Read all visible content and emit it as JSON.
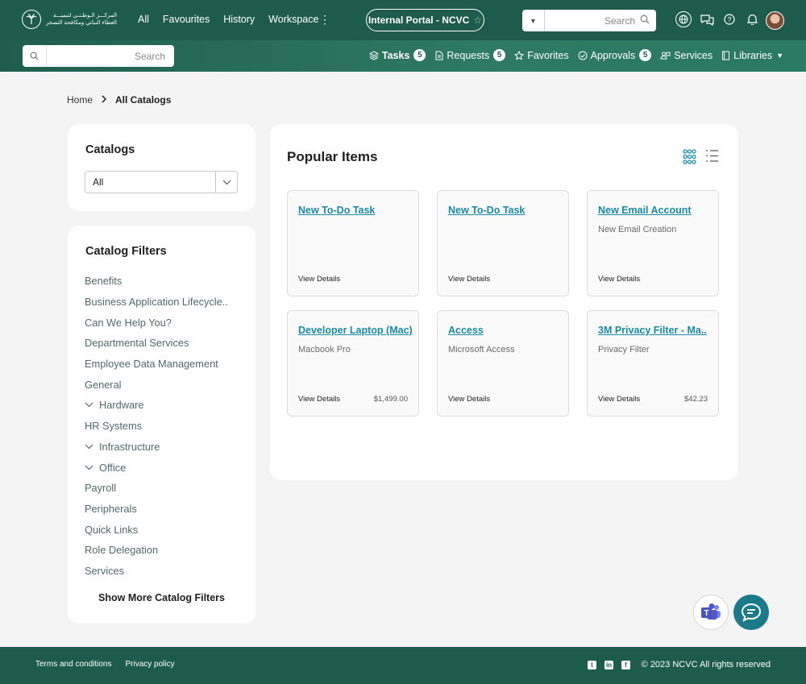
{
  "header": {
    "logo_text_line1": "المركـــز الـوطـنـي لتنميـــة",
    "logo_text_line2": "الغطاء النباتي ومكافحة التصحر",
    "nav": [
      "All",
      "Favourites",
      "History",
      "Workspace"
    ],
    "portal_label": "Internal Portal - NCVC",
    "search_placeholder": "Search",
    "icons": [
      "globe-icon",
      "chat-icon",
      "help-icon",
      "bell-icon"
    ]
  },
  "subbar": {
    "search_placeholder": "Search",
    "items": [
      {
        "label": "Tasks",
        "icon": "layers-icon",
        "badge": "5"
      },
      {
        "label": "Requests",
        "icon": "document-icon",
        "badge": "5"
      },
      {
        "label": "Favorites",
        "icon": "star-icon"
      },
      {
        "label": "Approvals",
        "icon": "check-circle-icon",
        "badge": "5"
      },
      {
        "label": "Services",
        "icon": "people-icon"
      },
      {
        "label": "Libraries",
        "icon": "book-icon"
      }
    ]
  },
  "breadcrumb": {
    "home": "Home",
    "current": "All Catalogs"
  },
  "catalogs": {
    "title": "Catalogs",
    "selected": "All"
  },
  "filters": {
    "title": "Catalog Filters",
    "items": [
      {
        "label": "Benefits",
        "expandable": false
      },
      {
        "label": "Business Application Lifecycle..",
        "expandable": false
      },
      {
        "label": "Can We Help You?",
        "expandable": false
      },
      {
        "label": "Departmental Services",
        "expandable": false
      },
      {
        "label": "Employee Data Management",
        "expandable": false
      },
      {
        "label": "General",
        "expandable": false
      },
      {
        "label": "Hardware",
        "expandable": true
      },
      {
        "label": "HR Systems",
        "expandable": false
      },
      {
        "label": "Infrastructure",
        "expandable": true
      },
      {
        "label": "Office",
        "expandable": true
      },
      {
        "label": "Payroll",
        "expandable": false
      },
      {
        "label": "Peripherals",
        "expandable": false
      },
      {
        "label": "Quick Links",
        "expandable": false
      },
      {
        "label": "Role Delegation",
        "expandable": false
      },
      {
        "label": "Services",
        "expandable": false
      }
    ],
    "show_more": "Show More Catalog Filters"
  },
  "popular": {
    "title": "Popular Items",
    "cards": [
      {
        "title": "New To-Do Task",
        "subtitle": "",
        "action": "View Details",
        "price": ""
      },
      {
        "title": "New To-Do Task",
        "subtitle": "",
        "action": "View Details",
        "price": ""
      },
      {
        "title": "New Email Account",
        "subtitle": "New Email Creation",
        "action": "View Details",
        "price": ""
      },
      {
        "title": "Developer Laptop (Mac)",
        "subtitle": "Macbook Pro",
        "action": "View Details",
        "price": "$1,499.00"
      },
      {
        "title": "Access",
        "subtitle": "Microsoft Access",
        "action": "View Details",
        "price": ""
      },
      {
        "title": "3M Privacy Filter - Ma..",
        "subtitle": "Privacy Filter",
        "action": "View Details",
        "price": "$42.23"
      }
    ]
  },
  "footer": {
    "links": [
      "Terms and conditions",
      "Privacy policy"
    ],
    "social": [
      "twitter-icon",
      "linkedin-icon",
      "facebook-icon"
    ],
    "copyright": "© 2023 NCVC  All rights reserved"
  },
  "colors": {
    "brand": "#1d5c4d",
    "link": "#1a8aa4",
    "filter_text": "#4f6b68"
  }
}
